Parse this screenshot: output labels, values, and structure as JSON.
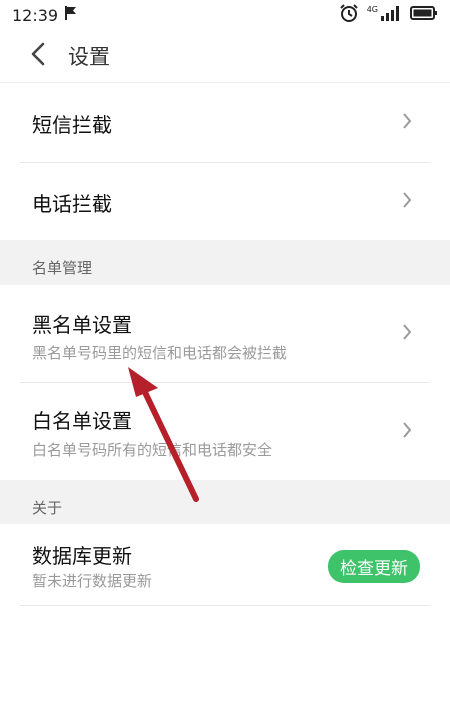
{
  "status": {
    "time": "12:39",
    "network": "4G"
  },
  "header": {
    "title": "设置"
  },
  "rows": {
    "sms_block": {
      "title": "短信拦截"
    },
    "call_block": {
      "title": "电话拦截"
    },
    "blacklist": {
      "title": "黑名单设置",
      "subtitle": "黑名单号码里的短信和电话都会被拦截"
    },
    "whitelist": {
      "title": "白名单设置",
      "subtitle": "白名单号码所有的短信和电话都安全"
    },
    "database": {
      "title": "数据库更新",
      "subtitle": "暂未进行数据更新",
      "button": "检查更新"
    }
  },
  "sections": {
    "list_management": "名单管理",
    "about": "关于"
  },
  "colors": {
    "accent": "#3ec26a",
    "annotation_arrow": "#b5202a"
  }
}
